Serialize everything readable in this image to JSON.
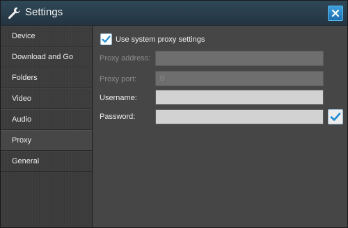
{
  "window": {
    "title": "Settings",
    "icon": "wrench-icon",
    "close_icon": "close-icon"
  },
  "sidebar": {
    "items": [
      {
        "label": "Device",
        "active": false
      },
      {
        "label": "Download and Go",
        "active": false
      },
      {
        "label": "Folders",
        "active": false
      },
      {
        "label": "Video",
        "active": false
      },
      {
        "label": "Audio",
        "active": false
      },
      {
        "label": "Proxy",
        "active": true
      },
      {
        "label": "General",
        "active": false
      }
    ]
  },
  "proxy": {
    "use_system_proxy": {
      "label": "Use system proxy settings",
      "checked": true
    },
    "address": {
      "label": "Proxy address:",
      "value": "",
      "disabled": true
    },
    "port": {
      "label": "Proxy port:",
      "value": "0",
      "disabled": true
    },
    "username": {
      "label": "Username:",
      "value": "",
      "disabled": false
    },
    "password": {
      "label": "Password:",
      "value": "",
      "disabled": false,
      "show_check": true
    }
  },
  "colors": {
    "accent": "#1f8ad2",
    "titlebar": "#2a3f4d",
    "content_bg": "#464646"
  }
}
